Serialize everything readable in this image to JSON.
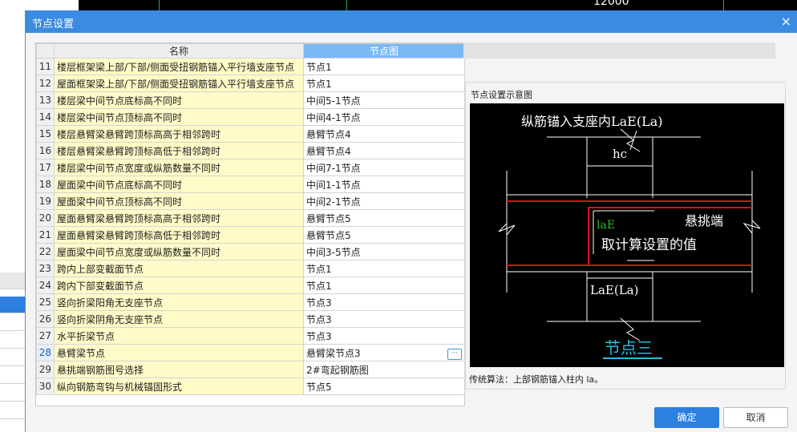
{
  "background": {
    "dimension_text": "12000"
  },
  "dialog": {
    "title": "节点设置",
    "close_glyph": "×",
    "ok_label": "确定",
    "cancel_label": "取消"
  },
  "table": {
    "headers": [
      "名称",
      "节点图"
    ],
    "rows": [
      {
        "num": "11",
        "name": "楼层框架梁上部/下部/侧面受扭钢筋锚入平行墙支座节点",
        "value": "节点1"
      },
      {
        "num": "12",
        "name": "屋面框架梁上部/下部/侧面受扭钢筋锚入平行墙支座节点",
        "value": "节点1"
      },
      {
        "num": "13",
        "name": "楼层梁中间节点底标高不同时",
        "value": "中间5-1节点"
      },
      {
        "num": "14",
        "name": "楼层梁中间节点顶标高不同时",
        "value": "中间4-1节点"
      },
      {
        "num": "15",
        "name": "楼层悬臂梁悬臂跨顶标高高于相邻跨时",
        "value": "悬臂节点4"
      },
      {
        "num": "16",
        "name": "楼层悬臂梁悬臂跨顶标高低于相邻跨时",
        "value": "悬臂节点4"
      },
      {
        "num": "17",
        "name": "楼层梁中间节点宽度或纵筋数量不同时",
        "value": "中间7-1节点"
      },
      {
        "num": "18",
        "name": "屋面梁中间节点底标高不同时",
        "value": "中间1-1节点"
      },
      {
        "num": "19",
        "name": "屋面梁中间节点顶标高不同时",
        "value": "中间2-1节点"
      },
      {
        "num": "20",
        "name": "屋面悬臂梁悬臂跨顶标高高于相邻跨时",
        "value": "悬臂节点5"
      },
      {
        "num": "21",
        "name": "屋面悬臂梁悬臂跨顶标高低于相邻跨时",
        "value": "悬臂节点5"
      },
      {
        "num": "22",
        "name": "屋面梁中间节点宽度或纵筋数量不同时",
        "value": "中间3-5节点"
      },
      {
        "num": "23",
        "name": "跨内上部变截面节点",
        "value": "节点1"
      },
      {
        "num": "24",
        "name": "跨内下部变截面节点",
        "value": "节点1"
      },
      {
        "num": "25",
        "name": "竖向折梁阳角无支座节点",
        "value": "节点3"
      },
      {
        "num": "26",
        "name": "竖向折梁阴角无支座节点",
        "value": "节点3"
      },
      {
        "num": "27",
        "name": "水平折梁节点",
        "value": "节点3"
      },
      {
        "num": "28",
        "name": "悬臂梁节点",
        "value": "悬臂梁节点3",
        "selected": true
      },
      {
        "num": "29",
        "name": "悬挑端钢筋图号选择",
        "value": "2#弯起钢筋图"
      },
      {
        "num": "30",
        "name": "纵向钢筋弯钩与机械锚固形式",
        "value": "节点5"
      }
    ],
    "ellipsis_glyph": "···"
  },
  "preview": {
    "title": "节点设置示意图",
    "note": "传统算法：上部钢筋锚入柱内 la。",
    "diagram": {
      "label_top": "纵筋锚入支座内LaE(La)",
      "label_hc": "hc",
      "label_lae": "laE",
      "label_cantilever": "悬挑端",
      "label_calc": "取计算设置的值",
      "label_bottom": "LaE(La)",
      "label_node": "节点三",
      "colors": {
        "rebar": "#e01010",
        "lae": "#20c020",
        "node": "#20c0e0"
      }
    }
  }
}
